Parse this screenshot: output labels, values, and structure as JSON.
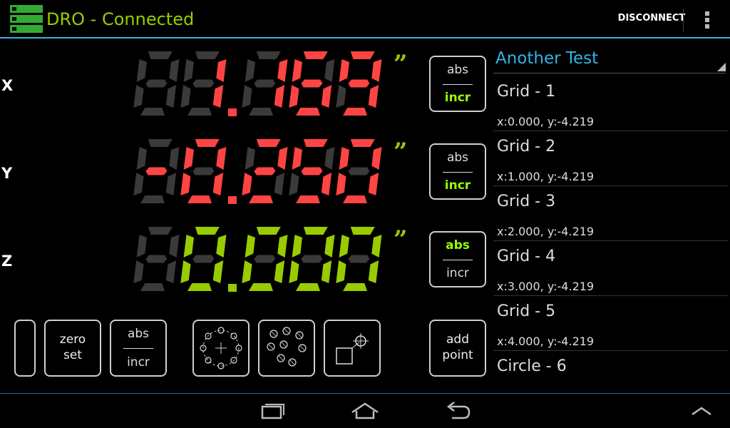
{
  "app": {
    "title": "DRO - Connected",
    "disconnect_label": "DISCONNECT"
  },
  "axes": [
    {
      "label": "X",
      "value": "1.169",
      "unit": "”",
      "color": "#ff4444",
      "mode": "incr"
    },
    {
      "label": "Y",
      "value": "-0.250",
      "unit": "”",
      "color": "#ff4444",
      "mode": "incr"
    },
    {
      "label": "Z",
      "value": "0.000",
      "unit": "”",
      "color": "#99cc00",
      "mode": "abs"
    }
  ],
  "toggle": {
    "top": "abs",
    "bottom": "incr"
  },
  "colors": {
    "accent": "#33b5e5",
    "active": "#99ff00",
    "x_y_digits": "#ff4444",
    "z_digits": "#99cc00",
    "unlit": "#3a3a3a"
  },
  "toolbar": {
    "zero_set_label": "zero\nset",
    "abs_label": "abs",
    "incr_label": "incr",
    "bolt_circle_icon": "bolt-circle-icon",
    "hole_grid_icon": "hole-grid-icon",
    "offset_icon": "offset-icon",
    "add_point_label": "add\npoint"
  },
  "list": {
    "title": "Another Test",
    "items": [
      {
        "name": "Grid - 1",
        "coord": "x:0.000, y:-4.219"
      },
      {
        "name": "Grid - 2",
        "coord": "x:1.000, y:-4.219"
      },
      {
        "name": "Grid - 3",
        "coord": "x:2.000, y:-4.219"
      },
      {
        "name": "Grid - 4",
        "coord": "x:3.000, y:-4.219"
      },
      {
        "name": "Grid - 5",
        "coord": "x:4.000, y:-4.219"
      },
      {
        "name": "Circle - 6",
        "coord": ""
      }
    ]
  },
  "nav": {
    "recent": "recent-apps-icon",
    "home": "home-icon",
    "back": "back-icon",
    "up": "chevron-up-icon"
  }
}
